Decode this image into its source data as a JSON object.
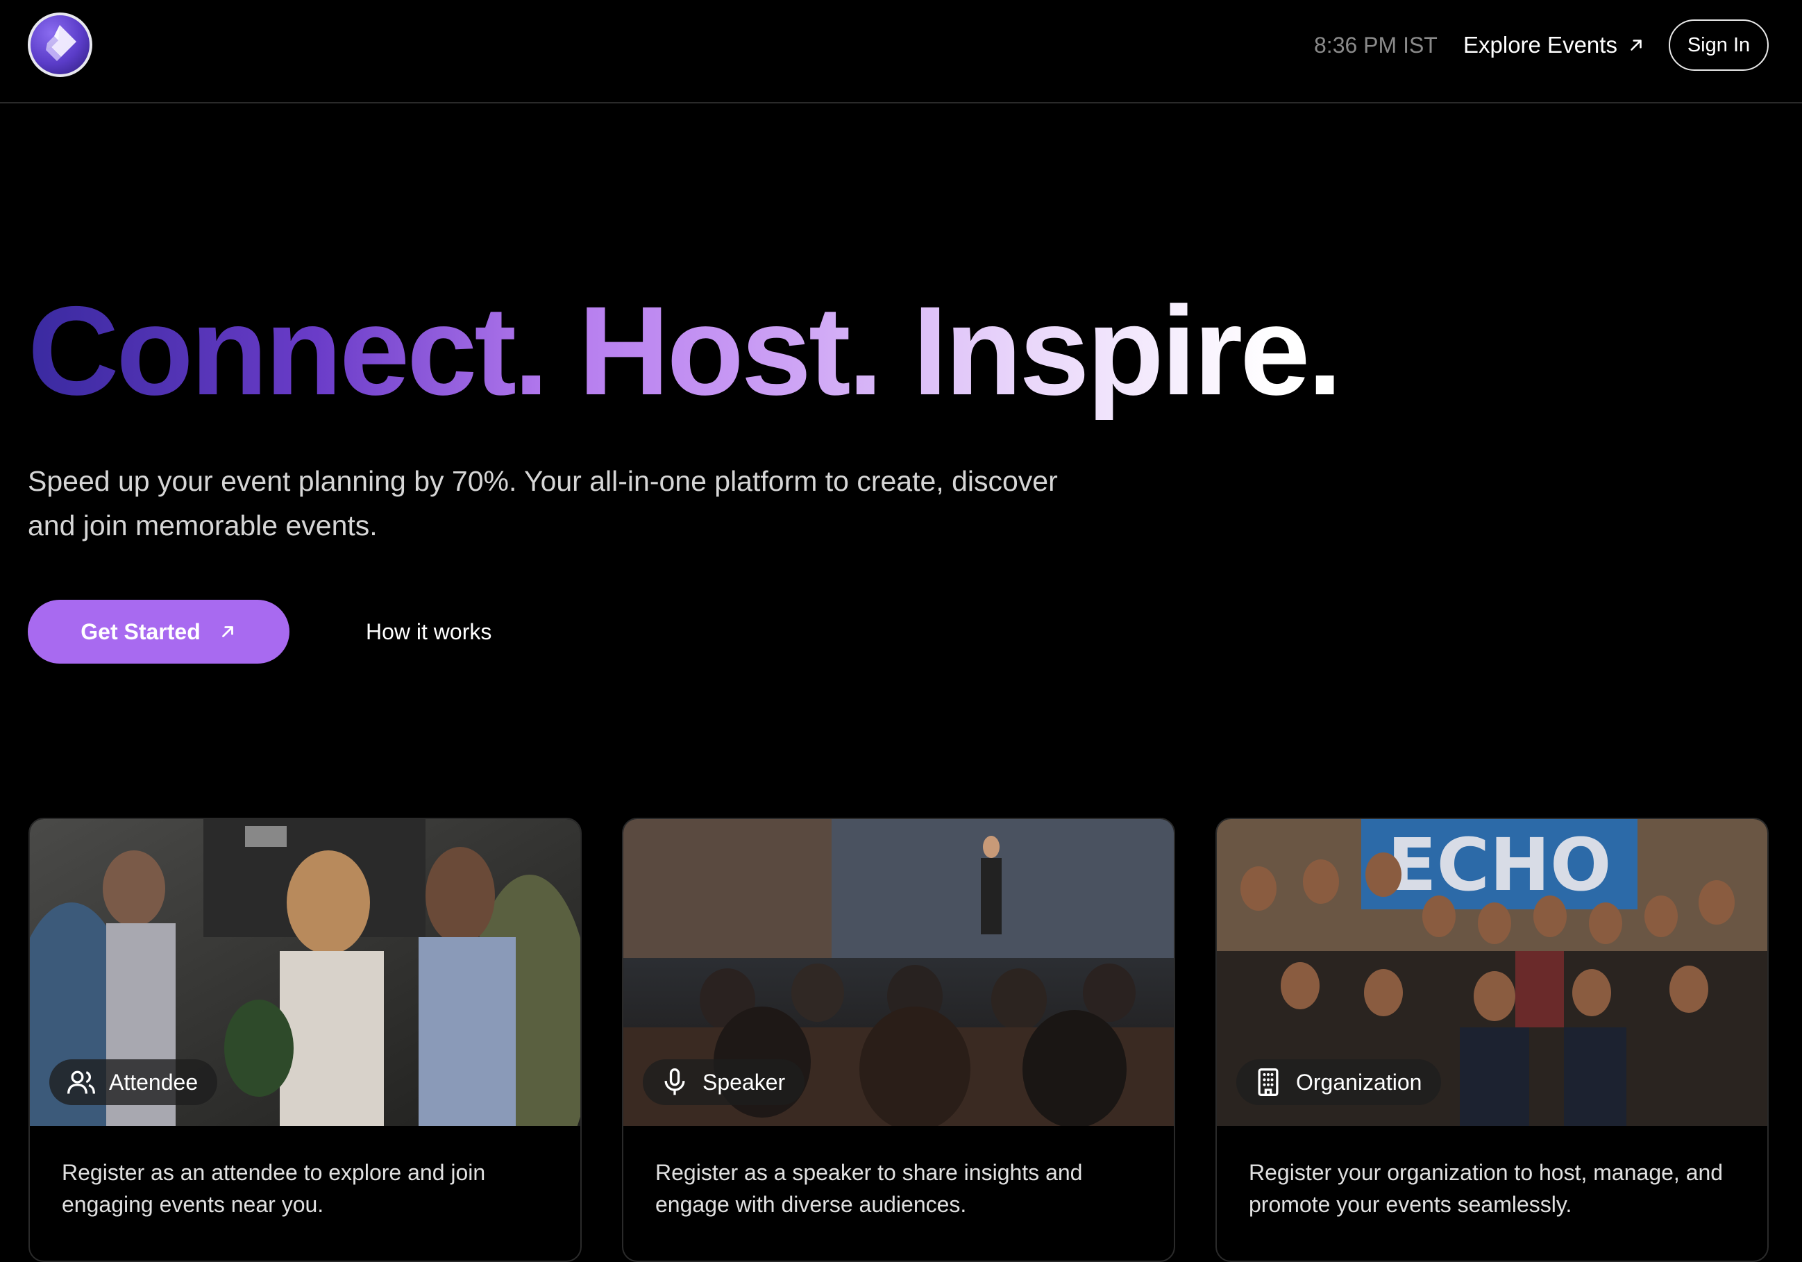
{
  "header": {
    "time": "8:36 PM IST",
    "explore_label": "Explore Events",
    "signin_label": "Sign In"
  },
  "hero": {
    "title": "Connect. Host. Inspire.",
    "subtitle_line1": "Speed up your event planning by 70%. Your all-in-one platform to create, discover",
    "subtitle_line2": "and join memorable events.",
    "cta_primary": "Get Started",
    "cta_secondary": "How it works"
  },
  "cards": [
    {
      "label": "Attendee",
      "icon": "users-icon",
      "description": "Register as an attendee to explore and join engaging events near you."
    },
    {
      "label": "Speaker",
      "icon": "microphone-icon",
      "description": "Register as a speaker to share insights and engage with diverse audiences."
    },
    {
      "label": "Organization",
      "icon": "building-icon",
      "description": "Register your organization to host, manage, and promote your events seamlessly.",
      "banner_text": "ECHO"
    }
  ],
  "colors": {
    "background": "#000000",
    "accent": "#a86af0",
    "muted_text": "#8a8a8a"
  }
}
